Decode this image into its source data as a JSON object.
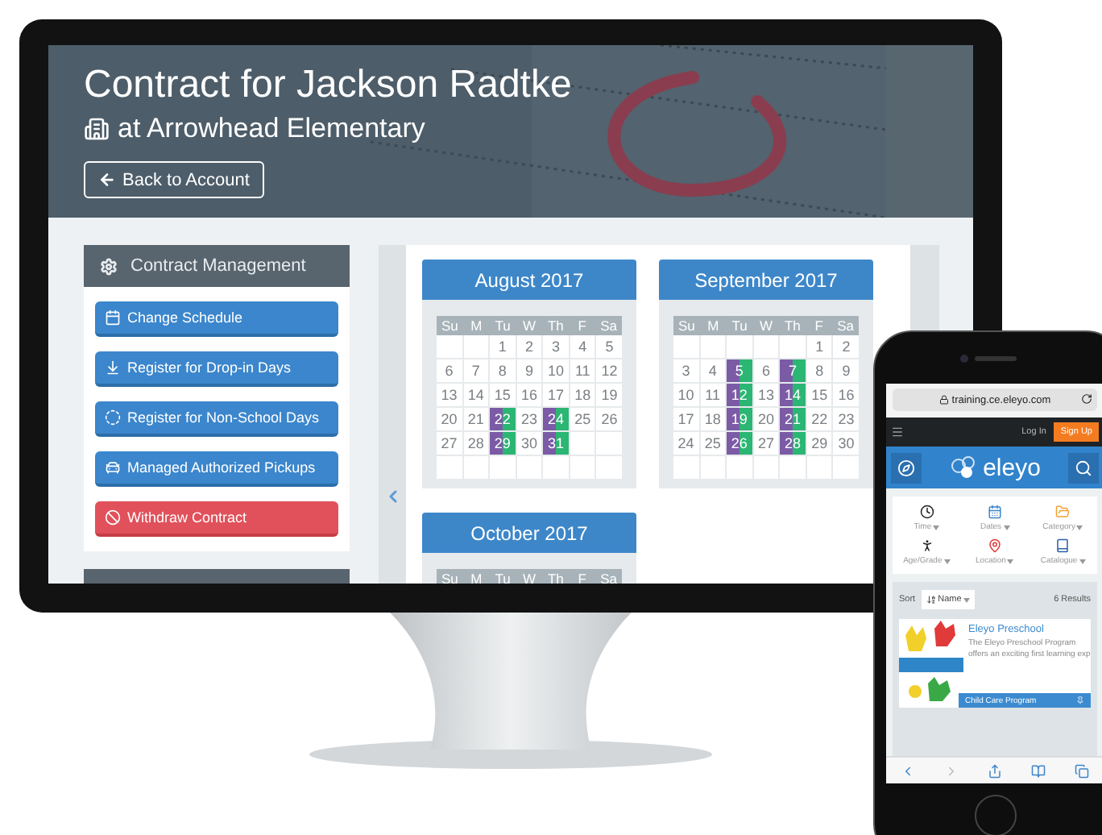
{
  "monitor": {
    "header": {
      "title": "Contract for Jackson Radtke",
      "subtitle": "at Arrowhead Elementary",
      "back_button": "Back to Account"
    },
    "sidebar": {
      "title": "Contract Management",
      "actions": [
        {
          "label": "Change Schedule",
          "kind": "primary"
        },
        {
          "label": "Register for Drop-in Days",
          "kind": "primary"
        },
        {
          "label": "Register for Non-School Days",
          "kind": "primary"
        },
        {
          "label": "Managed Authorized Pickups",
          "kind": "primary"
        },
        {
          "label": "Withdraw Contract",
          "kind": "danger"
        }
      ]
    },
    "calendars": [
      {
        "month": "August 2017",
        "weekdays": [
          "Su",
          "M",
          "Tu",
          "W",
          "Th",
          "F",
          "Sa"
        ],
        "weeks": [
          [
            {
              "blank": true
            },
            {
              "blank": true
            },
            {
              "day": "1",
              "marked": false
            },
            {
              "day": "2",
              "marked": false
            },
            {
              "day": "3",
              "marked": false
            },
            {
              "day": "4",
              "marked": false
            },
            {
              "day": "5",
              "marked": false
            }
          ],
          [
            {
              "day": "6",
              "marked": false
            },
            {
              "day": "7",
              "marked": false
            },
            {
              "day": "8",
              "marked": false
            },
            {
              "day": "9",
              "marked": false
            },
            {
              "day": "10",
              "marked": false
            },
            {
              "day": "11",
              "marked": false
            },
            {
              "day": "12",
              "marked": false
            }
          ],
          [
            {
              "day": "13",
              "marked": false
            },
            {
              "day": "14",
              "marked": false
            },
            {
              "day": "15",
              "marked": false
            },
            {
              "day": "16",
              "marked": false
            },
            {
              "day": "17",
              "marked": false
            },
            {
              "day": "18",
              "marked": false
            },
            {
              "day": "19",
              "marked": false
            }
          ],
          [
            {
              "day": "20",
              "marked": false
            },
            {
              "day": "21",
              "marked": false
            },
            {
              "day": "22",
              "marked": true
            },
            {
              "day": "23",
              "marked": false
            },
            {
              "day": "24",
              "marked": true
            },
            {
              "day": "25",
              "marked": false
            },
            {
              "day": "26",
              "marked": false
            }
          ],
          [
            {
              "day": "27",
              "marked": false
            },
            {
              "day": "28",
              "marked": false
            },
            {
              "day": "29",
              "marked": true
            },
            {
              "day": "30",
              "marked": false
            },
            {
              "day": "31",
              "marked": true
            },
            {
              "blank": true
            },
            {
              "blank": true
            }
          ]
        ]
      },
      {
        "month": "September 2017",
        "weekdays": [
          "Su",
          "M",
          "Tu",
          "W",
          "Th",
          "F",
          "Sa"
        ],
        "weeks": [
          [
            {
              "blank": true
            },
            {
              "blank": true
            },
            {
              "blank": true
            },
            {
              "blank": true
            },
            {
              "blank": true
            },
            {
              "day": "1",
              "marked": false
            },
            {
              "day": "2",
              "marked": false
            }
          ],
          [
            {
              "day": "3",
              "marked": false
            },
            {
              "day": "4",
              "marked": false
            },
            {
              "day": "5",
              "marked": true
            },
            {
              "day": "6",
              "marked": false
            },
            {
              "day": "7",
              "marked": true
            },
            {
              "day": "8",
              "marked": false
            },
            {
              "day": "9",
              "marked": false
            }
          ],
          [
            {
              "day": "10",
              "marked": false
            },
            {
              "day": "11",
              "marked": false
            },
            {
              "day": "12",
              "marked": true
            },
            {
              "day": "13",
              "marked": false
            },
            {
              "day": "14",
              "marked": true
            },
            {
              "day": "15",
              "marked": false
            },
            {
              "day": "16",
              "marked": false
            }
          ],
          [
            {
              "day": "17",
              "marked": false
            },
            {
              "day": "18",
              "marked": false
            },
            {
              "day": "19",
              "marked": true
            },
            {
              "day": "20",
              "marked": false
            },
            {
              "day": "21",
              "marked": true
            },
            {
              "day": "22",
              "marked": false
            },
            {
              "day": "23",
              "marked": false
            }
          ],
          [
            {
              "day": "24",
              "marked": false
            },
            {
              "day": "25",
              "marked": false
            },
            {
              "day": "26",
              "marked": true
            },
            {
              "day": "27",
              "marked": false
            },
            {
              "day": "28",
              "marked": true
            },
            {
              "day": "29",
              "marked": false
            },
            {
              "day": "30",
              "marked": false
            }
          ]
        ]
      },
      {
        "month": "October 2017",
        "weekdays": [
          "Su",
          "M",
          "Tu",
          "W",
          "Th",
          "F",
          "Sa"
        ]
      }
    ]
  },
  "phone": {
    "address": "training.ce.eleyo.com",
    "login": "Log In",
    "signup": "Sign Up",
    "logo": "eleyo",
    "filters": [
      {
        "label": "Time"
      },
      {
        "label": "Dates"
      },
      {
        "label": "Category"
      },
      {
        "label": "Age/Grade"
      },
      {
        "label": "Location"
      },
      {
        "label": "Catalogue"
      }
    ],
    "sort": {
      "label": "Sort",
      "value": "Name"
    },
    "results_count": "6 Results",
    "results": [
      {
        "title": "Eleyo Preschool",
        "description": "The Eleyo Preschool Program offers an exciting first learning exp",
        "tag": "Child Care Program"
      }
    ]
  }
}
